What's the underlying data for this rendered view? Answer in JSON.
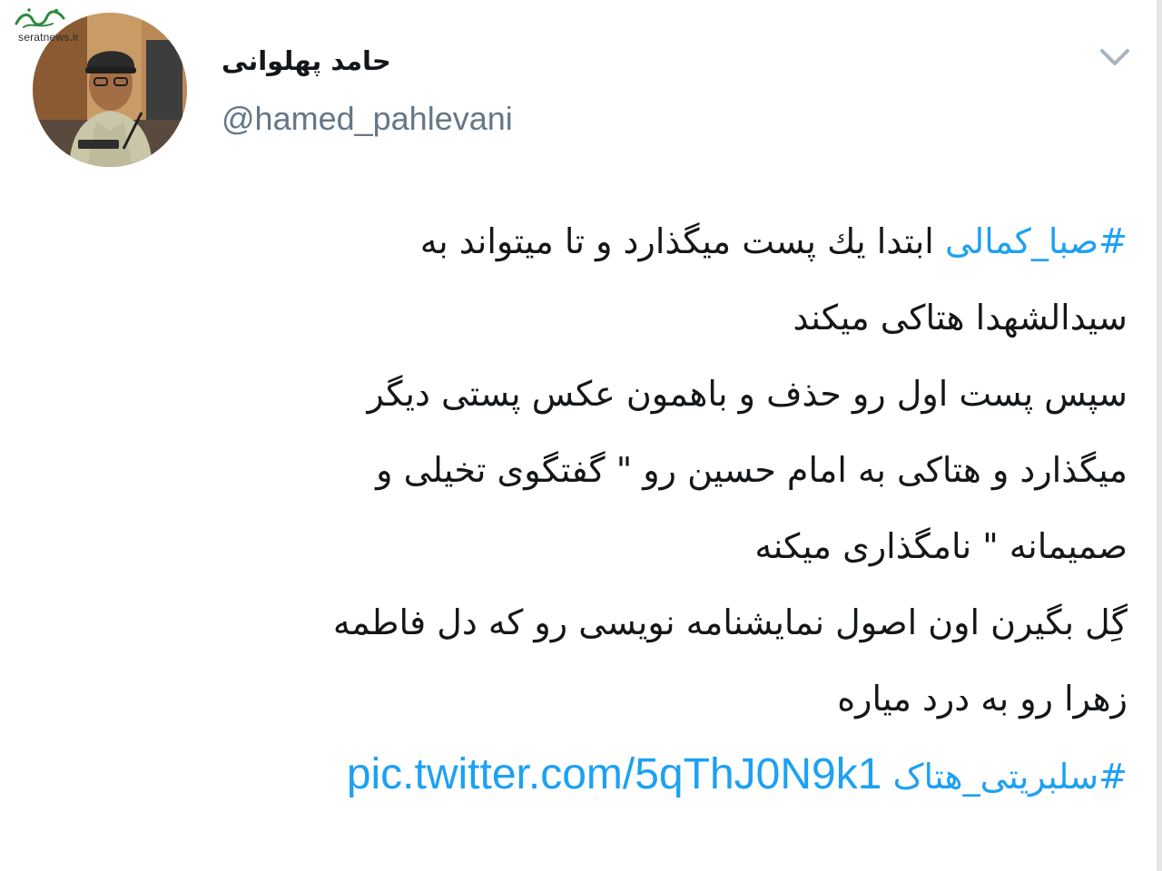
{
  "watermark": {
    "site": "seratnews.ir"
  },
  "author": {
    "display_name": "حامد پهلوانی",
    "handle": "@hamed_pahlevani"
  },
  "tweet": {
    "line1": {
      "hashtag": "#صبا_کمالی",
      "text": " ابتدا يك پست میگذارد و تا میتواند به"
    },
    "line2": "سیدالشهدا هتاکی میکند",
    "line3": "سپس پست اول رو حذف و باهمون عکس پستی دیگر",
    "line4": "میگذارد و هتاکی به امام حسین رو \" گفتگوی تخیلی و",
    "line5": "صمیمانه \" نامگذاری میکنه",
    "line6": "گِل بگیرن اون اصول نمایشنامه نویسی رو که دل فاطمه",
    "line7": "زهرا رو به درد میاره",
    "line8": {
      "hashtag": "#سلبریتی_هتاک",
      "link": "pic.twitter.com/5qThJ0N9k1"
    }
  },
  "icons": {
    "caret": "chevron-down-icon",
    "avatar": "profile-photo"
  },
  "colors": {
    "link": "#1da1f2",
    "handle": "#657786",
    "text": "#14171a",
    "caret": "#a7b4bf"
  }
}
